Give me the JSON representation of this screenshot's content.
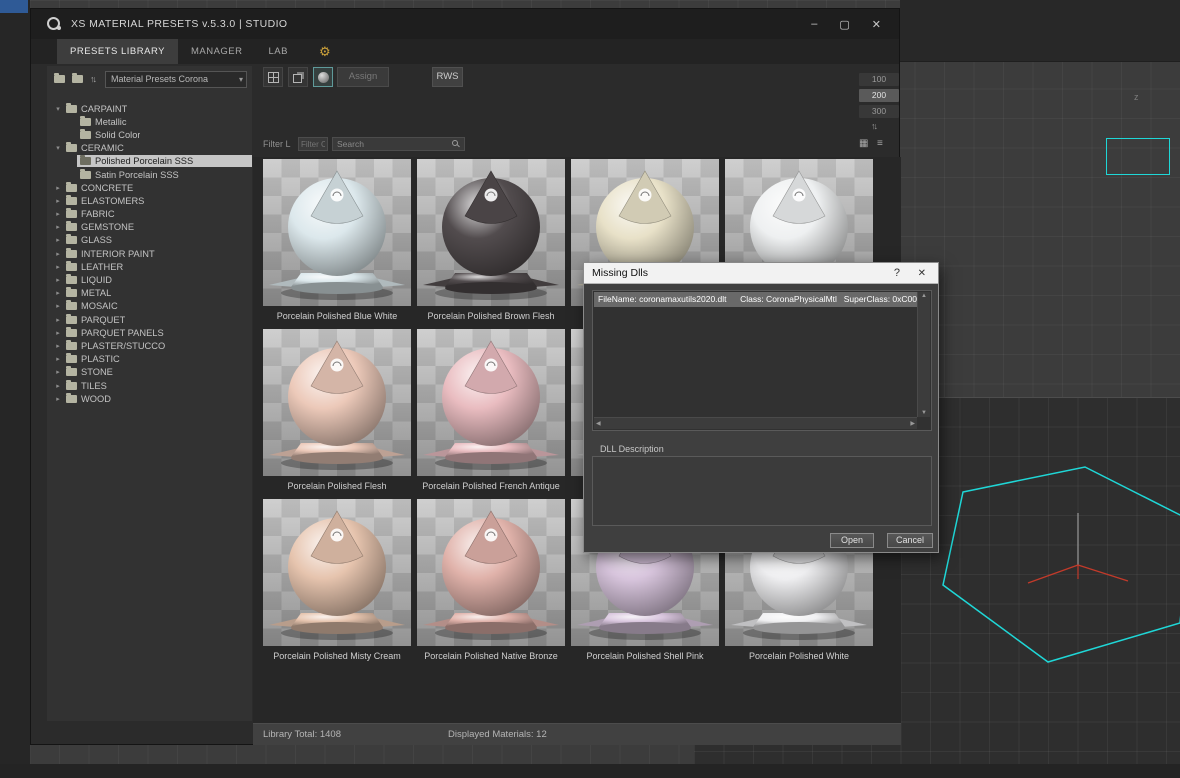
{
  "window": {
    "title": "XS MATERIAL PRESETS v.5.3.0 | STUDIO",
    "controls": {
      "minimize": "–",
      "maximize": "▢",
      "close": "✕"
    }
  },
  "menu": {
    "tabs": [
      {
        "label": "PRESETS LIBRARY",
        "active": true
      },
      {
        "label": "MANAGER",
        "active": false
      },
      {
        "label": "LAB",
        "active": false
      }
    ],
    "gear_glyph": "⚙",
    "gear_color": "#cda23a"
  },
  "sidebar": {
    "dropdown_value": "Material Presets Corona",
    "tree": [
      {
        "label": "CARPAINT",
        "level": 0,
        "expanded": true
      },
      {
        "label": "Metallic",
        "level": 1
      },
      {
        "label": "Solid Color",
        "level": 1
      },
      {
        "label": "CERAMIC",
        "level": 0,
        "expanded": true
      },
      {
        "label": "Polished Porcelain SSS",
        "level": 1,
        "selected": true
      },
      {
        "label": "Satin Porcelain SSS",
        "level": 1
      },
      {
        "label": "CONCRETE",
        "level": 0
      },
      {
        "label": "ELASTOMERS",
        "level": 0
      },
      {
        "label": "FABRIC",
        "level": 0
      },
      {
        "label": "GEMSTONE",
        "level": 0
      },
      {
        "label": "GLASS",
        "level": 0
      },
      {
        "label": "INTERIOR PAINT",
        "level": 0
      },
      {
        "label": "LEATHER",
        "level": 0
      },
      {
        "label": "LIQUID",
        "level": 0
      },
      {
        "label": "METAL",
        "level": 0
      },
      {
        "label": "MOSAIC",
        "level": 0
      },
      {
        "label": "PARQUET",
        "level": 0
      },
      {
        "label": "PARQUET PANELS",
        "level": 0
      },
      {
        "label": "PLASTER/STUCCO",
        "level": 0
      },
      {
        "label": "PLASTIC",
        "level": 0
      },
      {
        "label": "STONE",
        "level": 0
      },
      {
        "label": "TILES",
        "level": 0
      },
      {
        "label": "WOOD",
        "level": 0
      }
    ]
  },
  "toolbar": {
    "assign_label": "Assign",
    "rws_label": "RWS",
    "sizes": [
      {
        "label": "100",
        "active": false
      },
      {
        "label": "200",
        "active": true
      },
      {
        "label": "300",
        "active": false
      }
    ]
  },
  "filters": {
    "filter_l_label": "Filter L",
    "filter_c_placeholder": "Filter C",
    "search_placeholder": "Search"
  },
  "materials": {
    "items": [
      {
        "label": "Porcelain Polished Blue White",
        "color": "#dce8ec"
      },
      {
        "label": "Porcelain Polished Brown Flesh",
        "color": "#524c4e"
      },
      {
        "label": "",
        "color": "#e8e1c8"
      },
      {
        "label": "",
        "color": "#eef0f1"
      },
      {
        "label": "Porcelain Polished Flesh",
        "color": "#ecc9b9"
      },
      {
        "label": "Porcelain Polished French Antique",
        "color": "#e9bcc0"
      },
      {
        "label": "",
        "color": "#d8d8d8"
      },
      {
        "label": "",
        "color": "#d8d8d8"
      },
      {
        "label": "Porcelain Polished Misty Cream",
        "color": "#e6c4ae"
      },
      {
        "label": "Porcelain Polished Native Bronze",
        "color": "#e0b2aa"
      },
      {
        "label": "Porcelain Polished Shell Pink",
        "color": "#d9c6de"
      },
      {
        "label": "Porcelain Polished White",
        "color": "#f0f0f2"
      }
    ]
  },
  "status": {
    "library_total": "Library Total: 1408",
    "displayed_materials": "Displayed Materials: 12"
  },
  "dialog": {
    "title": "Missing Dlls",
    "help_label": "?",
    "close_label": "✕",
    "list_row": {
      "filename": "FileName:  coronamaxutils2020.dlt",
      "class": "Class:  CoronaPhysicalMtl",
      "superclass": "SuperClass: 0xC00"
    },
    "description_label": "DLL Description",
    "open_label": "Open",
    "cancel_label": "Cancel"
  },
  "viewport": {
    "z_axis_label": "z",
    "selection_color": "#1fd7d7"
  }
}
